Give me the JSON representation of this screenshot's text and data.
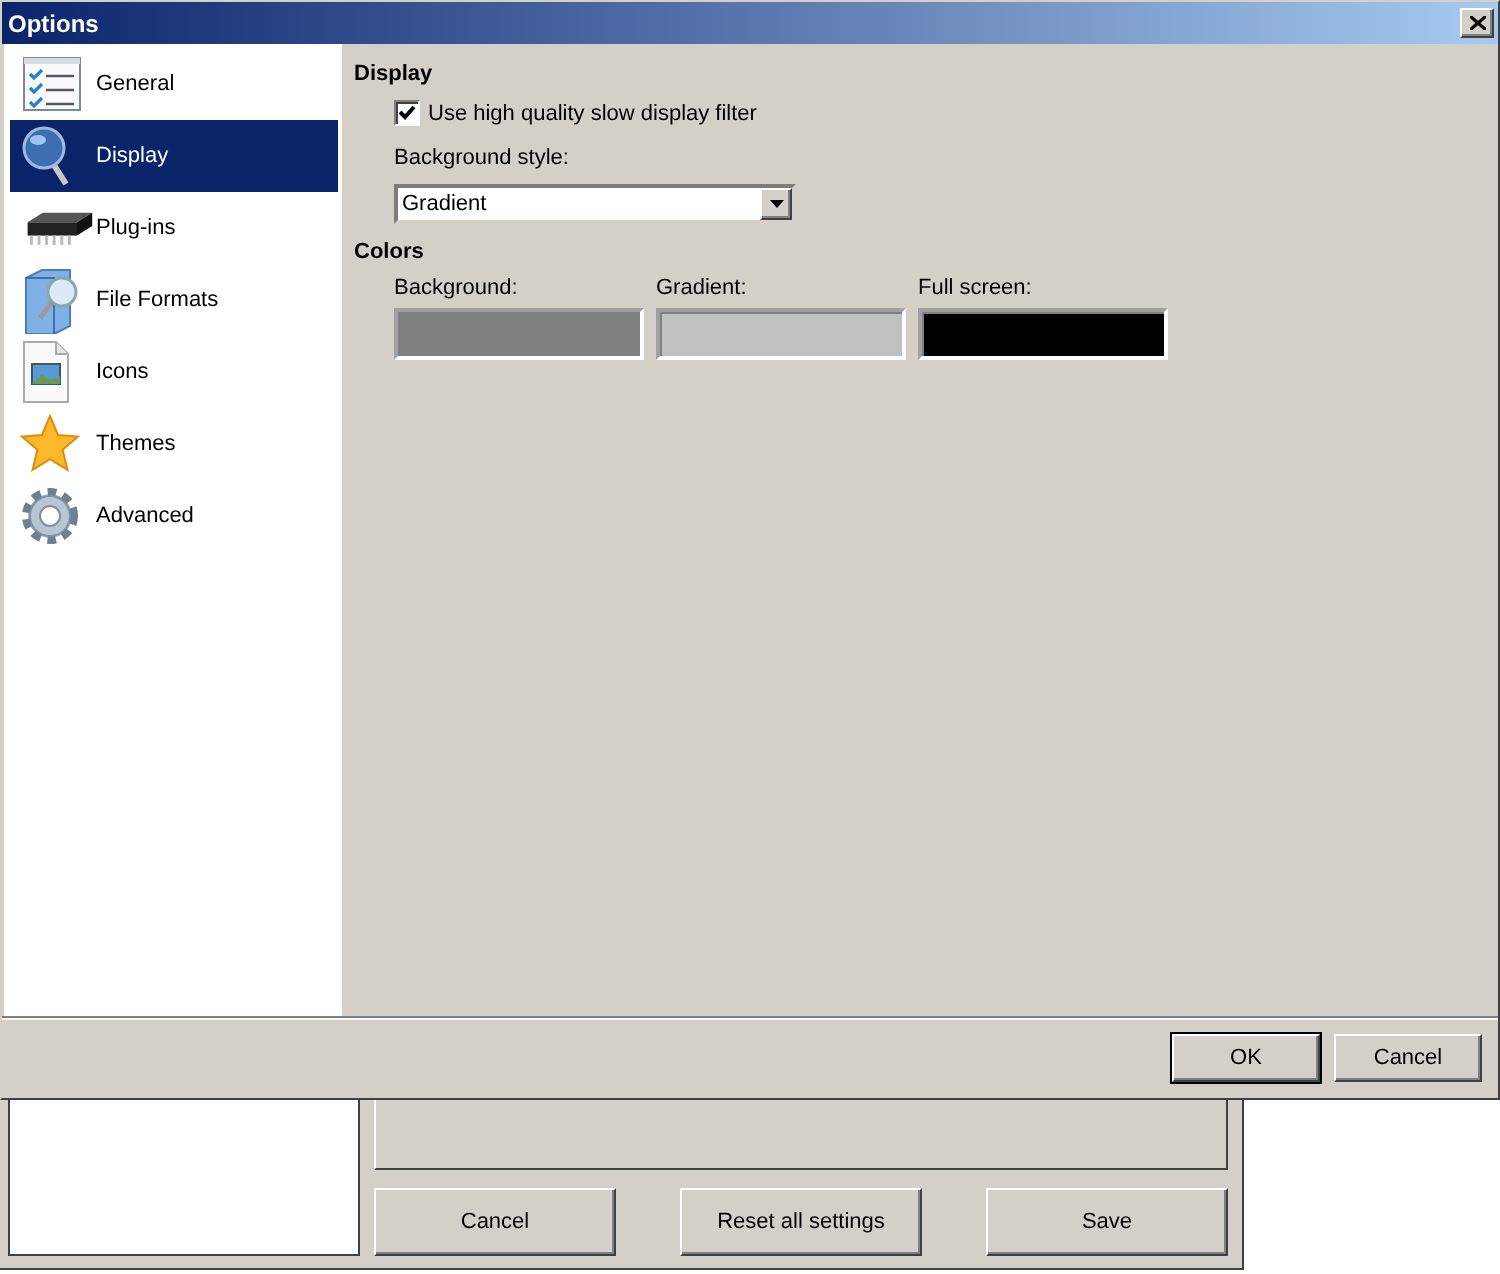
{
  "window": {
    "title": "Options"
  },
  "sidebar": {
    "items": [
      {
        "label": "General",
        "selected": false
      },
      {
        "label": "Display",
        "selected": true
      },
      {
        "label": "Plug-ins",
        "selected": false
      },
      {
        "label": "File Formats",
        "selected": false
      },
      {
        "label": "Icons",
        "selected": false
      },
      {
        "label": "Themes",
        "selected": false
      },
      {
        "label": "Advanced",
        "selected": false
      }
    ]
  },
  "display_section": {
    "heading": "Display",
    "checkbox": {
      "label": "Use high quality slow display filter",
      "checked": true
    },
    "background_style": {
      "label": "Background style:",
      "value": "Gradient"
    }
  },
  "colors_section": {
    "heading": "Colors",
    "swatches": [
      {
        "label": "Background:",
        "color": "#808080"
      },
      {
        "label": "Gradient:",
        "color": "#c0c0c0"
      },
      {
        "label": "Full screen:",
        "color": "#000000"
      }
    ]
  },
  "buttons": [
    {
      "label": "OK",
      "default": true
    },
    {
      "label": "Cancel",
      "default": false
    }
  ],
  "background_window": {
    "buttons": [
      "Cancel",
      "Reset all settings",
      "Save"
    ]
  }
}
